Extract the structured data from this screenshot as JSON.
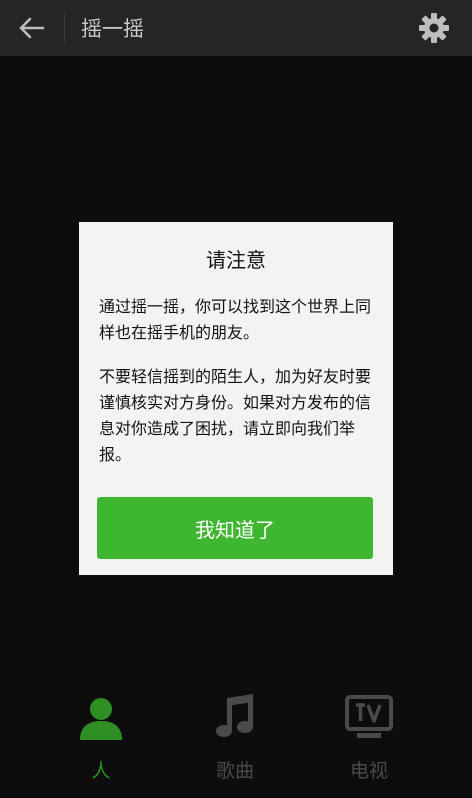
{
  "header": {
    "title": "摇一摇",
    "back_icon": "arrow-left-icon",
    "settings_icon": "gear-icon"
  },
  "dialog": {
    "title": "请注意",
    "paragraph1": "通过摇一摇，你可以找到这个世界上同样也在摇手机的朋友。",
    "paragraph2": "不要轻信摇到的陌生人，加为好友时要谨慎核实对方身份。如果对方发布的信息对你造成了困扰，请立即向我们举报。",
    "confirm_label": "我知道了"
  },
  "tabs": [
    {
      "label": "人",
      "icon": "person-icon",
      "active": true
    },
    {
      "label": "歌曲",
      "icon": "music-note-icon",
      "active": false
    },
    {
      "label": "电视",
      "icon": "tv-icon",
      "active": false
    }
  ],
  "colors": {
    "accent": "#3fb62f",
    "tab_active": "#2f8f25",
    "tab_inactive": "#4a4a4a"
  }
}
